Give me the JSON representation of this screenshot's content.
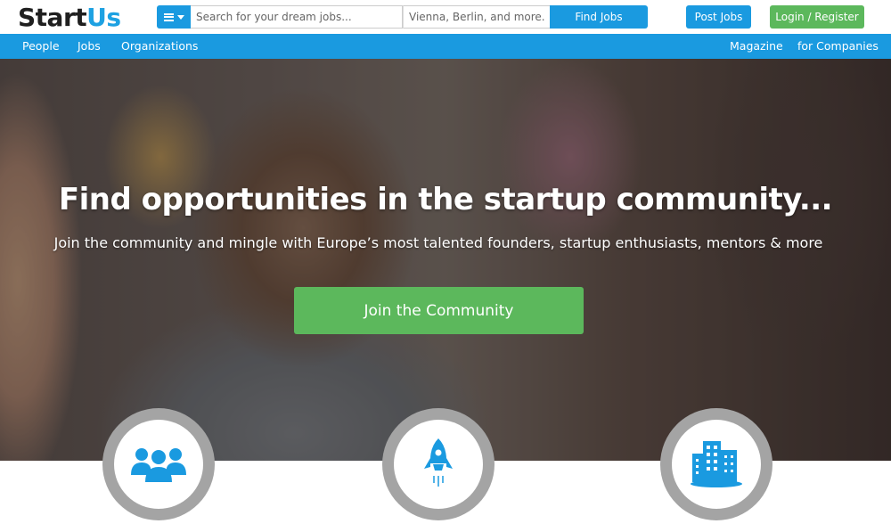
{
  "header": {
    "logo_start": "Start",
    "logo_us": "Us",
    "search_placeholder": "Search for your dream jobs...",
    "location_placeholder": "Vienna, Berlin, and more...",
    "find_jobs_label": "Find Jobs",
    "post_jobs_label": "Post Jobs",
    "login_label": "Login / Register"
  },
  "nav": {
    "left": [
      "People",
      "Jobs",
      "Organizations"
    ],
    "right": [
      "Magazine",
      "for Companies"
    ]
  },
  "hero": {
    "title": "Find opportunities in the startup community...",
    "subtitle": "Join the community and mingle with Europe’s most talented founders, startup enthusiasts, mentors & more",
    "cta_label": "Join the Community"
  },
  "features": [
    {
      "icon": "people-group-icon"
    },
    {
      "icon": "rocket-icon"
    },
    {
      "icon": "buildings-icon"
    }
  ],
  "colors": {
    "brand_blue": "#1a9ae0",
    "cta_green": "#5cb85c",
    "logo_dark": "#1f1f1f"
  }
}
